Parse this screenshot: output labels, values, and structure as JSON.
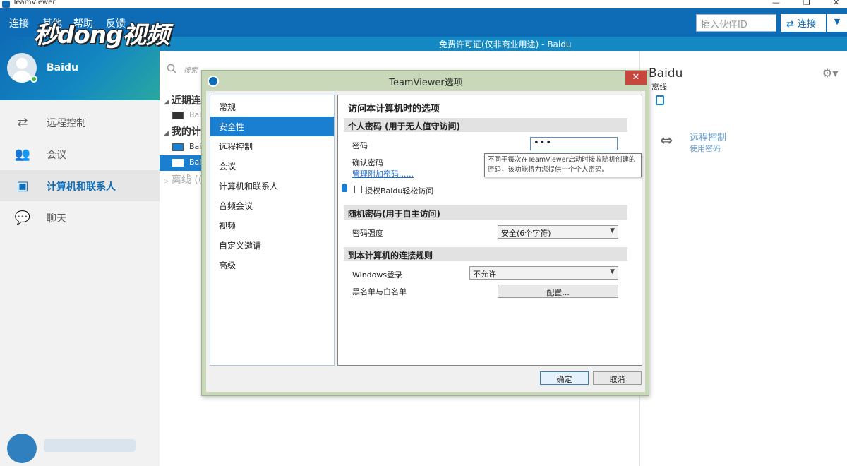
{
  "window": {
    "app_title": "TeamViewer",
    "controls": [
      "—",
      "❐",
      "✕"
    ]
  },
  "menu": [
    "连接",
    "其他",
    "帮助",
    "反馈"
  ],
  "watermark": "秒dong视频",
  "topbar": {
    "partner_placeholder": "插入伙伴ID",
    "connect_label": "连接"
  },
  "license_text": "免费许可证(仅非商业用途) - Baidu",
  "profile": {
    "name": "Baidu"
  },
  "nav": [
    {
      "label": "远程控制",
      "icon": "arrows-icon",
      "active": false
    },
    {
      "label": "会议",
      "icon": "group-icon",
      "active": false
    },
    {
      "label": "计算机和联系人",
      "icon": "contacts-icon",
      "active": true
    },
    {
      "label": "聊天",
      "icon": "chat-icon",
      "active": false
    }
  ],
  "contacts": {
    "search_placeholder": "搜索",
    "recent_header": "近期连",
    "my_header": "我的计",
    "recent_item": "Bai",
    "my_items": [
      "Bai",
      "Bai"
    ],
    "offline_header": "离线 (("
  },
  "right_panel": {
    "name": "Baidu",
    "status": "离线",
    "remote_label": "远程控制",
    "remote_sub": "使用密码"
  },
  "dialog": {
    "title": "TeamViewer选项",
    "categories": [
      "常规",
      "安全性",
      "远程控制",
      "会议",
      "计算机和联系人",
      "音频会议",
      "视频",
      "自定义邀请",
      "高级"
    ],
    "active_category": 1,
    "panel_title": "访问本计算机时的选项",
    "section_personal": "个人密码 (用于无人值守访问)",
    "password_label": "密码",
    "password_value": "•••",
    "confirm_label": "确认密码",
    "manage_link": "管理附加密码......",
    "tooltip": "不同于每次在TeamViewer启动时接收随机创建的密码，该功能将为您提供一个个人密码。",
    "grant_easy_access": "授权Baidu轻松访问",
    "section_random": "随机密码(用于自主访问)",
    "strength_label": "密码强度",
    "strength_value": "安全(6个字符)",
    "section_rules": "到本计算机的连接规则",
    "windows_login_label": "Windows登录",
    "windows_login_value": "不允许",
    "blacklist_label": "黑名单与白名单",
    "configure_button": "配置...",
    "ok_button": "确定",
    "cancel_button": "取消"
  }
}
